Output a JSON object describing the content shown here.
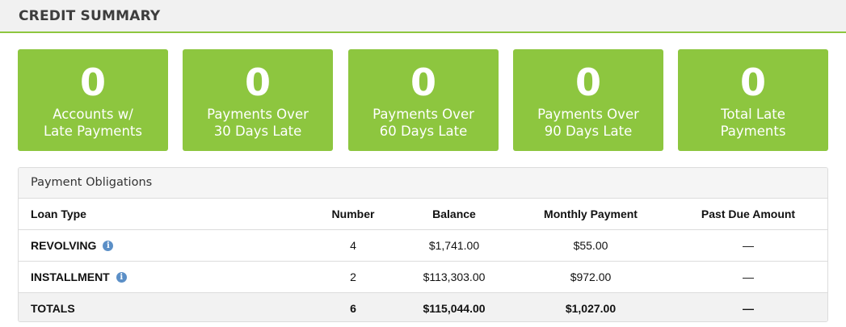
{
  "header": {
    "title": "CREDIT SUMMARY"
  },
  "cards": [
    {
      "value": "0",
      "label_line1": "Accounts w/",
      "label_line2": "Late Payments"
    },
    {
      "value": "0",
      "label_line1": "Payments Over",
      "label_line2": "30 Days Late"
    },
    {
      "value": "0",
      "label_line1": "Payments Over",
      "label_line2": "60 Days Late"
    },
    {
      "value": "0",
      "label_line1": "Payments Over",
      "label_line2": "90 Days Late"
    },
    {
      "value": "0",
      "label_line1": "Total Late",
      "label_line2": "Payments"
    }
  ],
  "panel": {
    "title": "Payment Obligations",
    "columns": [
      "Loan Type",
      "Number",
      "Balance",
      "Monthly Payment",
      "Past Due Amount"
    ],
    "rows": [
      {
        "loan_type": "REVOLVING",
        "info_icon": "info-icon",
        "number": "4",
        "balance": "$1,741.00",
        "monthly_payment": "$55.00",
        "past_due": "—"
      },
      {
        "loan_type": "INSTALLMENT",
        "info_icon": "info-icon",
        "number": "2",
        "balance": "$113,303.00",
        "monthly_payment": "$972.00",
        "past_due": "—"
      }
    ],
    "totals": {
      "label": "TOTALS",
      "number": "6",
      "balance": "$115,044.00",
      "monthly_payment": "$1,027.00",
      "past_due": "—"
    }
  },
  "colors": {
    "accent_green": "#8dc63f",
    "info_blue": "#5b8fc7",
    "header_bg": "#f1f1f1"
  }
}
